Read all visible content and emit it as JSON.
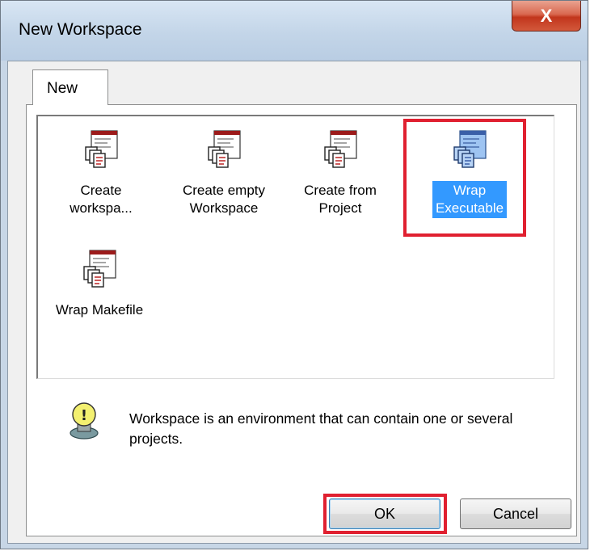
{
  "window": {
    "title": "New Workspace",
    "close_glyph": "X"
  },
  "tabs": [
    {
      "label": "New"
    }
  ],
  "items": [
    {
      "line1": "Create",
      "line2": "workspa...",
      "icon": "workspace-document-icon",
      "selected": false
    },
    {
      "line1": "Create empty",
      "line2": "Workspace",
      "icon": "workspace-document-icon",
      "selected": false
    },
    {
      "line1": "Create from",
      "line2": "Project",
      "icon": "workspace-document-icon",
      "selected": false
    },
    {
      "line1": "Wrap",
      "line2": "Executable",
      "icon": "workspace-document-icon",
      "selected": true
    },
    {
      "line1": "Wrap Makefile",
      "line2": "",
      "icon": "workspace-document-icon",
      "selected": false
    }
  ],
  "info": {
    "icon": "lightbulb-hint-icon",
    "text": "Workspace is an environment that can contain one or several projects."
  },
  "buttons": {
    "ok_label": "OK",
    "cancel_label": "Cancel"
  },
  "colors": {
    "highlight": "#e02030",
    "selection": "#3399ff"
  }
}
